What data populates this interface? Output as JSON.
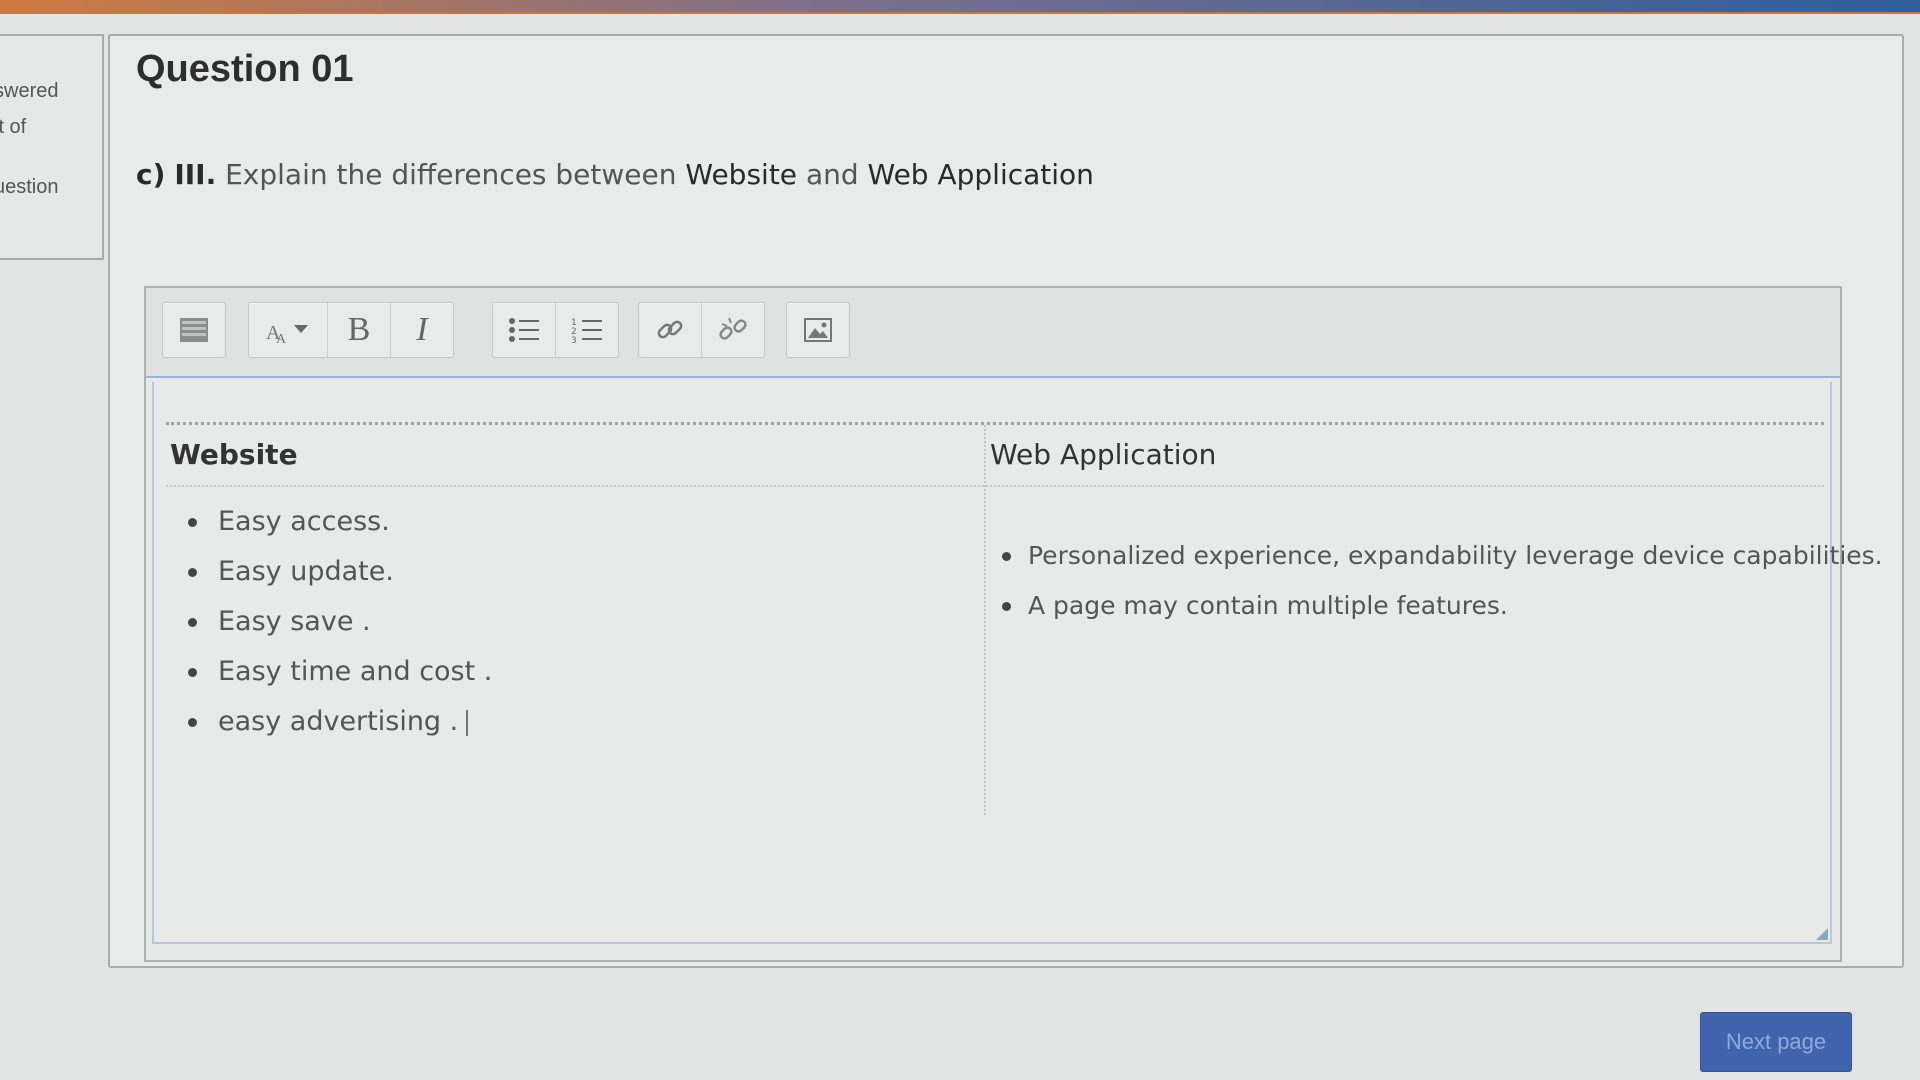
{
  "sidebar_info": {
    "line1": "swered",
    "line2": "it of",
    "line3": "uestion"
  },
  "question": {
    "title": "Question 01",
    "prefix_label": "c)",
    "roman": "III.",
    "text_part1": "Explain the differences between",
    "term1": "Website",
    "and_word": "and",
    "term2": "Web Application"
  },
  "toolbar": {
    "buttons": [
      {
        "name": "toggle-toolbar-icon",
        "glyph": "▦"
      },
      {
        "name": "font-style-icon",
        "glyph": "A▾"
      },
      {
        "name": "bold-icon",
        "glyph": "B"
      },
      {
        "name": "italic-icon",
        "glyph": "I"
      },
      {
        "name": "bullet-list-icon",
        "glyph": "☰"
      },
      {
        "name": "numbered-list-icon",
        "glyph": "☰"
      },
      {
        "name": "link-icon",
        "glyph": "🔗"
      },
      {
        "name": "unlink-icon",
        "glyph": "⛓"
      },
      {
        "name": "image-icon",
        "glyph": "🖼"
      }
    ]
  },
  "answer_table": {
    "left_header": "Website",
    "right_header": "Web Application",
    "left_items": [
      "Easy access.",
      "Easy update.",
      "Easy save .",
      "Easy  time and cost .",
      "easy advertising ."
    ],
    "right_items": [
      "Personalized experience, expandability leverage device capabilities.",
      "A page may contain multiple features."
    ]
  },
  "footer": {
    "next_label": "Next page"
  },
  "colors": {
    "accent_blue": "#3f64ad",
    "top_bar_orange": "#cf7a3e"
  }
}
